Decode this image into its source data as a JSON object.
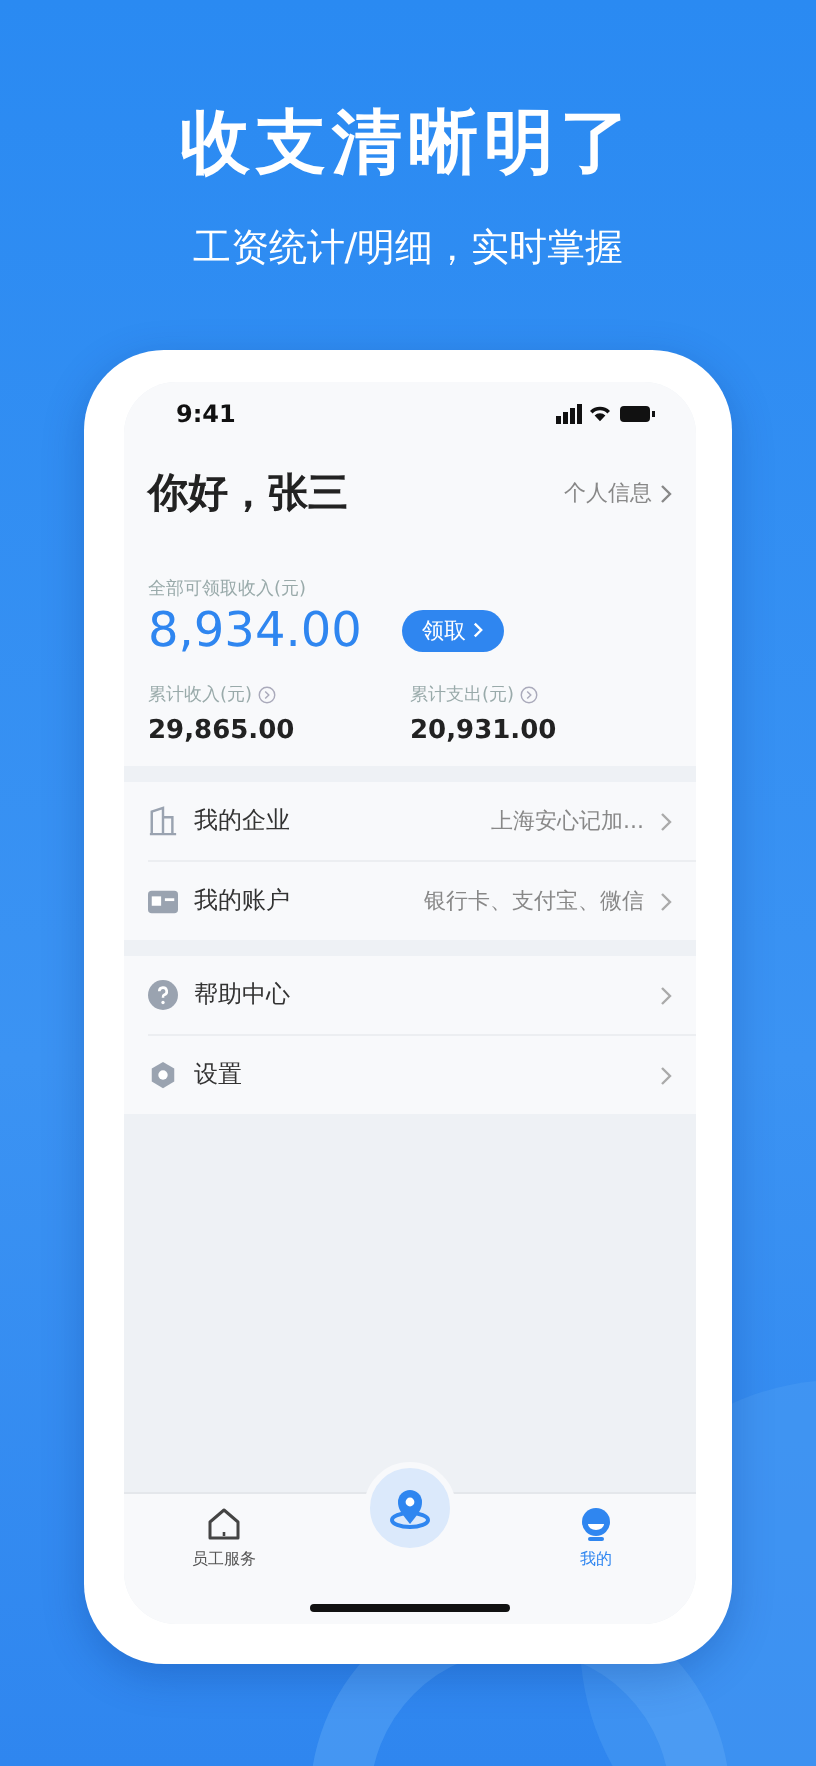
{
  "headline": "收支清晰明了",
  "subtitle": "工资统计/明细，实时掌握",
  "status_bar": {
    "time": "9:41"
  },
  "greeting": "你好，张三",
  "profile_link": "个人信息",
  "available": {
    "label": "全部可领取收入(元)",
    "amount": "8,934.00",
    "button": "领取"
  },
  "stats": [
    {
      "label": "累计收入(元)",
      "value": "29,865.00"
    },
    {
      "label": "累计支出(元)",
      "value": "20,931.00"
    }
  ],
  "menu_groups": [
    [
      {
        "label": "我的企业",
        "value": "上海安心记加..."
      },
      {
        "label": "我的账户",
        "value": "银行卡、支付宝、微信"
      }
    ],
    [
      {
        "label": "帮助中心"
      },
      {
        "label": "设置"
      }
    ]
  ],
  "tabs": [
    {
      "kind": "tab",
      "label": "员工服务",
      "selected": false
    },
    {
      "kind": "center"
    },
    {
      "kind": "tab",
      "label": "我的",
      "selected": true
    }
  ]
}
